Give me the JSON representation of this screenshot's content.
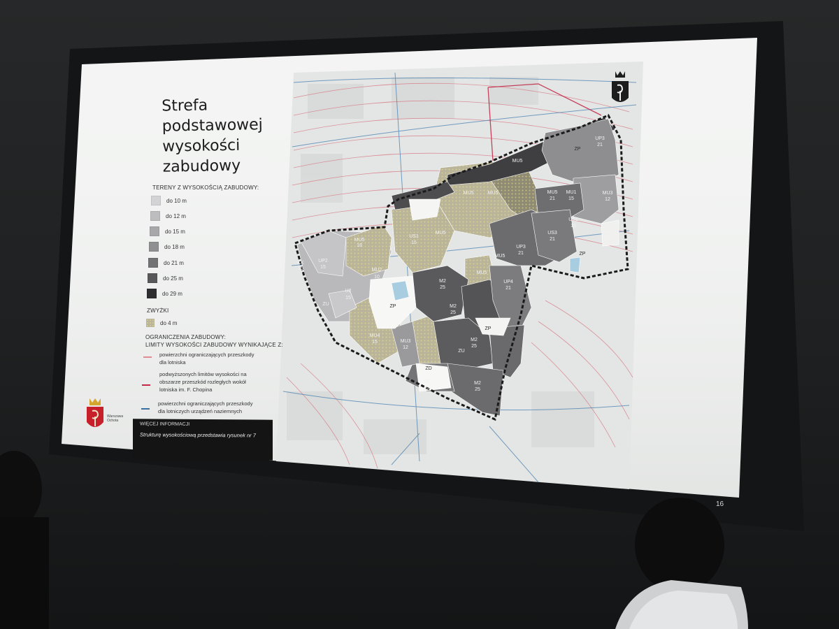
{
  "slide": {
    "title_lines": [
      "Strefa",
      "podstawowej",
      "wysokości",
      "zabudowy"
    ],
    "section_heights_header": "TERENY Z WYSOKOŚCIĄ ZABUDOWY:",
    "height_legend": [
      {
        "label": "do 10 m",
        "color": "#d3d3d5"
      },
      {
        "label": "do 12 m",
        "color": "#bdbdbf"
      },
      {
        "label": "do 15 m",
        "color": "#a8a8aa"
      },
      {
        "label": "do 18 m",
        "color": "#8f8f91"
      },
      {
        "label": "do 21 m",
        "color": "#727274"
      },
      {
        "label": "do 25 m",
        "color": "#58585a"
      },
      {
        "label": "do 29 m",
        "color": "#2e2e30"
      }
    ],
    "zwyzki_header": "ZWYŻKI",
    "zwyzki_item": "do 4 m",
    "limits_header_1": "OGRANICZENIA ZABUDOWY:",
    "limits_header_2": "LIMITY WYSOKOŚCI ZABUDOWY WYNIKAJĄCE Z:",
    "limits": [
      {
        "lines": [
          "powierzchni ograniczających przeszkody",
          "dla lotniska"
        ],
        "color": "#e08a94"
      },
      {
        "lines": [
          "podwyższonych limitów wysokości na",
          "obszarze przeszkód rozległych wokół",
          "lotniska im. F. Chopina"
        ],
        "color": "#c9274a"
      },
      {
        "lines": [
          "powierzchni ograniczających przeszkody",
          "dla lotniczych urządzeń naziemnych"
        ],
        "color": "#3b6fa0"
      }
    ],
    "info_header": "WIĘCEJ INFORMACJI",
    "info_body": "Strukturę wysokościową przedstawia rysunek nr 7",
    "logo_text_1": "Warszawa",
    "logo_text_2": "Ochota",
    "page_number": "16"
  },
  "map": {
    "zone_labels": [
      {
        "code": "MU5",
        "height": "18"
      },
      {
        "code": "MU3",
        "height": "18"
      },
      {
        "code": "UP2",
        "height": "15"
      },
      {
        "code": "KK",
        "height": "15"
      },
      {
        "code": "U2",
        "height": "15"
      },
      {
        "code": "MU2",
        "height": "10"
      },
      {
        "code": "U2",
        "height": "15"
      },
      {
        "code": "ZP",
        "height": ""
      },
      {
        "code": "ZU",
        "height": ""
      },
      {
        "code": "MU4",
        "height": "15"
      },
      {
        "code": "MU3",
        "height": "12"
      },
      {
        "code": "ZD",
        "height": ""
      },
      {
        "code": "KK",
        "height": "15"
      },
      {
        "code": "M2",
        "height": "25"
      },
      {
        "code": "M2",
        "height": "25"
      },
      {
        "code": "UP4",
        "height": "21"
      },
      {
        "code": "UP3",
        "height": "21"
      },
      {
        "code": "US3",
        "height": "21"
      },
      {
        "code": "UP3",
        "height": "21"
      },
      {
        "code": "MU3",
        "height": "12"
      },
      {
        "code": "UP4",
        "height": "21"
      },
      {
        "code": "ZP",
        "height": ""
      },
      {
        "code": "US1",
        "height": "15"
      },
      {
        "code": "MU5",
        "height": "21"
      },
      {
        "code": "ZP",
        "height": ""
      },
      {
        "code": "MU1",
        "height": "15"
      }
    ]
  }
}
